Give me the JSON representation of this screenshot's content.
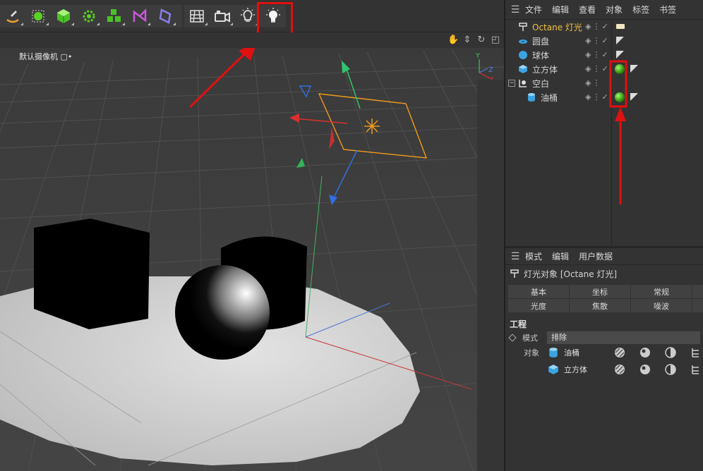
{
  "toolbar": {
    "buttons": [
      {
        "name": "spline-pen-icon"
      },
      {
        "name": "subdivision-icon"
      },
      {
        "name": "cube-object-icon"
      },
      {
        "name": "cloner-icon"
      },
      {
        "name": "mograph-icon"
      },
      {
        "name": "deformer-icon"
      },
      {
        "name": "field-icon"
      },
      {
        "name": "floor-grid-icon"
      },
      {
        "name": "camera-icon"
      },
      {
        "name": "light-icon"
      },
      {
        "name": "octane-light-icon"
      }
    ]
  },
  "viewport": {
    "camera_label": "默认摄像机 ",
    "camera_glyph": "▢•",
    "axis_labels": {
      "y": "Y",
      "z": "Z",
      "x": "X"
    }
  },
  "object_manager": {
    "menu": [
      "文件",
      "编辑",
      "查看",
      "对象",
      "标签",
      "书签"
    ],
    "objects": [
      {
        "name": "Octane 灯光",
        "icon": "light-object-icon",
        "indent": 0,
        "highlight": true
      },
      {
        "name": "圆盘",
        "icon": "disc-object-icon",
        "indent": 0
      },
      {
        "name": "球体",
        "icon": "sphere-object-icon",
        "indent": 0
      },
      {
        "name": "立方体",
        "icon": "cube-object-icon",
        "indent": 0
      },
      {
        "name": "空白",
        "icon": "null-object-icon",
        "indent": 0,
        "expanded": true
      },
      {
        "name": "油桶",
        "icon": "cylinder-object-icon",
        "indent": 1
      }
    ]
  },
  "attribute_manager": {
    "menu": [
      "模式",
      "编辑",
      "用户数据"
    ],
    "title": "灯光对象 [Octane 灯光]",
    "tabs": [
      [
        "基本",
        "坐标",
        "常规"
      ],
      [
        "光度",
        "焦散",
        "噪波"
      ]
    ],
    "section": "工程",
    "mode_label": "模式",
    "mode_value": "排除",
    "objects_label": "对象",
    "objects": [
      {
        "name": "油桶",
        "icon": "cylinder-object-icon"
      },
      {
        "name": "立方体",
        "icon": "cube-object-icon"
      }
    ]
  },
  "colors": {
    "highlight": "#e01010",
    "octane_label": "#f0c040",
    "accent_green": "#3ab02a"
  }
}
